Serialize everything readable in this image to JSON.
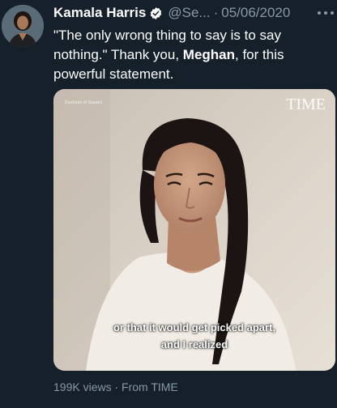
{
  "tweet": {
    "author_name": "Kamala Harris",
    "handle": "@Se...",
    "separator": "·",
    "date": "05/06/2020",
    "text_part1": "\"The only wrong thing to say is to say nothing.\" Thank you, ",
    "mention": "Meghan",
    "text_part2": ", for this powerful statement.",
    "icons": {
      "verified": "verified-badge-icon",
      "more": "more-options-icon"
    },
    "colors": {
      "background": "#15202b",
      "secondary_text": "#8899a6",
      "verified_blue": "#ffffff"
    }
  },
  "media": {
    "label": "Duchess of Sussex",
    "brand": "TIME",
    "caption_line1": "or that it would get picked apart,",
    "caption_line2": "and I realized"
  },
  "footer": {
    "views": "199K views",
    "separator": "·",
    "source": "From TIME"
  }
}
